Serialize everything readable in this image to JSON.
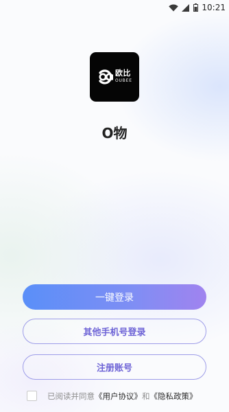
{
  "status_bar": {
    "time": "10:21",
    "icons": [
      "wifi-icon",
      "signal-icon",
      "battery-icon"
    ]
  },
  "logo": {
    "cn": "欧比",
    "en": "OUBEE"
  },
  "app_name": "O物",
  "buttons": {
    "one_click_login": "一键登录",
    "other_phone_login": "其他手机号登录",
    "register": "注册账号"
  },
  "agreement": {
    "prefix": "已阅读并同意",
    "user_agreement": "《用户协议》",
    "conjunction": "和",
    "privacy_policy": "《隐私政策》",
    "checked": false
  },
  "colors": {
    "primary_gradient_start": "#5a8ff8",
    "primary_gradient_end": "#a083ef",
    "outline_border": "#9c9be8",
    "outline_text": "#6d63d6"
  }
}
